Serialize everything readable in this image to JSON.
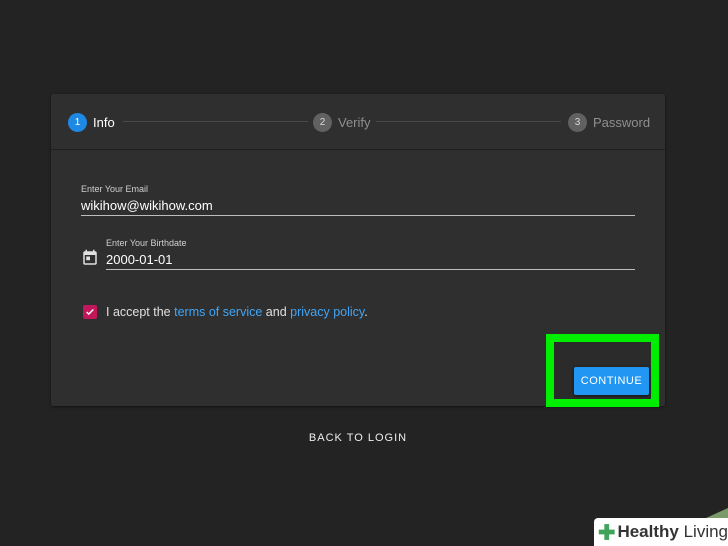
{
  "stepper": {
    "steps": [
      {
        "number": "1",
        "label": "Info",
        "active": true
      },
      {
        "number": "2",
        "label": "Verify",
        "active": false
      },
      {
        "number": "3",
        "label": "Password",
        "active": false
      }
    ]
  },
  "form": {
    "email": {
      "label": "Enter Your Email",
      "value": "wikihow@wikihow.com"
    },
    "birthdate": {
      "label": "Enter Your Birthdate",
      "value": "2000-01-01"
    },
    "terms": {
      "checked": true,
      "prefix": "I accept the ",
      "terms_link": "terms of service",
      "middle": " and ",
      "privacy_link": "privacy policy",
      "suffix": "."
    },
    "continue_label": "CONTINUE"
  },
  "back_to_login": "BACK TO LOGIN",
  "watermark": {
    "brand": "Healthy",
    "suffix": " Living"
  },
  "colors": {
    "background": "#232323",
    "card": "#2f2f2f",
    "accent": "#2196f3",
    "checkbox": "#c2185b",
    "highlight": "#00ee00",
    "link": "#42a5f5"
  }
}
